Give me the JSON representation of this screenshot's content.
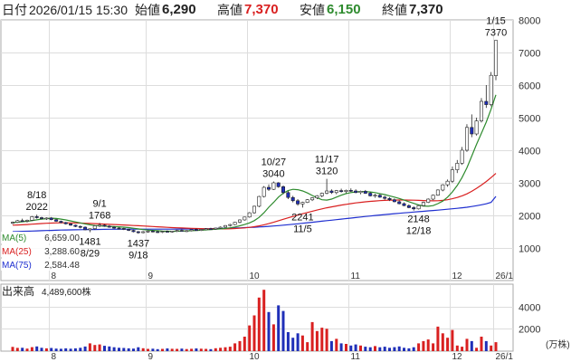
{
  "header": {
    "date_label": "日付",
    "date_value": "2026/01/15 15:30",
    "open_label": "始値",
    "open_value": "6,290",
    "high_label": "高値",
    "high_value": "7,370",
    "low_label": "安値",
    "low_value": "6,150",
    "close_label": "終値",
    "close_value": "7,370"
  },
  "colors": {
    "up_candle": "#ffffff",
    "down_candle": "#1f2fb8",
    "ma5": "#2e8b2e",
    "ma25": "#d92020",
    "ma75": "#1f2fd0",
    "volume_up": "#d92020",
    "volume_down": "#1f2fb8",
    "high_value_text": "#d92020",
    "low_value_text": "#2e8b2e"
  },
  "chart_data": {
    "type": "candlestick",
    "price_panel": {
      "ylim": [
        0,
        8000
      ],
      "y_ticks": [
        1000,
        2000,
        3000,
        4000,
        5000,
        6000,
        7000,
        8000
      ],
      "x_tick_labels": [
        "8",
        "9",
        "10",
        "11",
        "12",
        "26/1"
      ],
      "grid": true,
      "legend": [
        {
          "name": "MA(5)",
          "value": "6,659.00",
          "color": "#2e8b2e"
        },
        {
          "name": "MA(25)",
          "value": "3,288.60",
          "color": "#d92020"
        },
        {
          "name": "MA(75)",
          "value": "2,584.48",
          "color": "#1f2fd0"
        }
      ],
      "legend_placement": "bottom-left",
      "annotations": [
        {
          "date": "8/18",
          "value": "2022",
          "kind": "high"
        },
        {
          "date": "9/1",
          "value": "1768",
          "kind": "high"
        },
        {
          "date": "8/29",
          "value": "1481",
          "kind": "low"
        },
        {
          "date": "9/18",
          "value": "1437",
          "kind": "low"
        },
        {
          "date": "10/27",
          "value": "3040",
          "kind": "high"
        },
        {
          "date": "11/17",
          "value": "3120",
          "kind": "high"
        },
        {
          "date": "11/5",
          "value": "2241",
          "kind": "low"
        },
        {
          "date": "12/18",
          "value": "2148",
          "kind": "low"
        },
        {
          "date": "1/15",
          "value": "7370",
          "kind": "high"
        }
      ]
    },
    "volume_panel": {
      "label": "出来高",
      "value": "4,489,600株",
      "unit": "(万株)",
      "ylim": [
        0,
        6000
      ],
      "y_ticks": [
        2000,
        4000
      ],
      "x_tick_labels": [
        "8",
        "9",
        "10",
        "11",
        "12",
        "26/1"
      ]
    },
    "candles": [
      [
        1760,
        1810,
        1730,
        1790
      ],
      [
        1790,
        1860,
        1770,
        1840
      ],
      [
        1840,
        1900,
        1800,
        1820
      ],
      [
        1820,
        1870,
        1780,
        1850
      ],
      [
        1850,
        1980,
        1830,
        1960
      ],
      [
        1960,
        2022,
        1900,
        1930
      ],
      [
        1930,
        1960,
        1880,
        1900
      ],
      [
        1900,
        1940,
        1860,
        1920
      ],
      [
        1920,
        1950,
        1850,
        1870
      ],
      [
        1870,
        1890,
        1800,
        1820
      ],
      [
        1820,
        1840,
        1760,
        1780
      ],
      [
        1780,
        1800,
        1720,
        1740
      ],
      [
        1740,
        1760,
        1680,
        1700
      ],
      [
        1700,
        1720,
        1640,
        1660
      ],
      [
        1660,
        1690,
        1600,
        1640
      ],
      [
        1640,
        1660,
        1540,
        1560
      ],
      [
        1560,
        1600,
        1481,
        1590
      ],
      [
        1590,
        1700,
        1560,
        1680
      ],
      [
        1680,
        1768,
        1640,
        1700
      ],
      [
        1700,
        1730,
        1650,
        1670
      ],
      [
        1670,
        1700,
        1620,
        1640
      ],
      [
        1640,
        1660,
        1590,
        1610
      ],
      [
        1610,
        1640,
        1570,
        1600
      ],
      [
        1600,
        1620,
        1550,
        1570
      ],
      [
        1570,
        1590,
        1520,
        1540
      ],
      [
        1540,
        1560,
        1480,
        1500
      ],
      [
        1500,
        1520,
        1437,
        1470
      ],
      [
        1470,
        1520,
        1450,
        1500
      ],
      [
        1500,
        1540,
        1470,
        1520
      ],
      [
        1520,
        1550,
        1480,
        1500
      ],
      [
        1500,
        1530,
        1460,
        1490
      ],
      [
        1490,
        1520,
        1460,
        1510
      ],
      [
        1510,
        1540,
        1480,
        1500
      ],
      [
        1500,
        1530,
        1470,
        1520
      ],
      [
        1520,
        1560,
        1490,
        1540
      ],
      [
        1540,
        1570,
        1500,
        1520
      ],
      [
        1520,
        1550,
        1490,
        1530
      ],
      [
        1530,
        1570,
        1510,
        1560
      ],
      [
        1560,
        1600,
        1530,
        1540
      ],
      [
        1540,
        1580,
        1520,
        1570
      ],
      [
        1570,
        1610,
        1550,
        1590
      ],
      [
        1590,
        1620,
        1560,
        1580
      ],
      [
        1580,
        1620,
        1560,
        1610
      ],
      [
        1610,
        1660,
        1590,
        1640
      ],
      [
        1640,
        1700,
        1620,
        1690
      ],
      [
        1690,
        1740,
        1660,
        1720
      ],
      [
        1720,
        1800,
        1700,
        1790
      ],
      [
        1790,
        1880,
        1760,
        1860
      ],
      [
        1860,
        1960,
        1840,
        1950
      ],
      [
        1950,
        2100,
        1930,
        2080
      ],
      [
        2080,
        2300,
        2050,
        2280
      ],
      [
        2280,
        2600,
        2250,
        2580
      ],
      [
        2580,
        2900,
        2550,
        2860
      ],
      [
        2860,
        2950,
        2750,
        2800
      ],
      [
        2800,
        3040,
        2780,
        3000
      ],
      [
        3000,
        3020,
        2850,
        2880
      ],
      [
        2880,
        2920,
        2650,
        2700
      ],
      [
        2700,
        2750,
        2500,
        2550
      ],
      [
        2550,
        2600,
        2400,
        2450
      ],
      [
        2450,
        2500,
        2300,
        2350
      ],
      [
        2350,
        2420,
        2241,
        2400
      ],
      [
        2400,
        2500,
        2380,
        2480
      ],
      [
        2480,
        2560,
        2440,
        2540
      ],
      [
        2540,
        2620,
        2500,
        2600
      ],
      [
        2600,
        2700,
        2560,
        2680
      ],
      [
        2680,
        3120,
        2650,
        2750
      ],
      [
        2750,
        2800,
        2660,
        2700
      ],
      [
        2700,
        2780,
        2650,
        2760
      ],
      [
        2760,
        2820,
        2700,
        2730
      ],
      [
        2730,
        2790,
        2680,
        2770
      ],
      [
        2770,
        2830,
        2720,
        2750
      ],
      [
        2750,
        2800,
        2680,
        2700
      ],
      [
        2700,
        2760,
        2650,
        2740
      ],
      [
        2740,
        2780,
        2660,
        2680
      ],
      [
        2680,
        2720,
        2580,
        2600
      ],
      [
        2600,
        2660,
        2540,
        2620
      ],
      [
        2620,
        2660,
        2540,
        2560
      ],
      [
        2560,
        2600,
        2480,
        2520
      ],
      [
        2520,
        2560,
        2440,
        2480
      ],
      [
        2480,
        2520,
        2400,
        2420
      ],
      [
        2420,
        2460,
        2340,
        2360
      ],
      [
        2360,
        2400,
        2280,
        2300
      ],
      [
        2300,
        2340,
        2220,
        2240
      ],
      [
        2240,
        2280,
        2148,
        2200
      ],
      [
        2200,
        2320,
        2180,
        2300
      ],
      [
        2300,
        2420,
        2280,
        2400
      ],
      [
        2400,
        2520,
        2380,
        2500
      ],
      [
        2500,
        2640,
        2470,
        2620
      ],
      [
        2620,
        2800,
        2600,
        2780
      ],
      [
        2780,
        2960,
        2740,
        2940
      ],
      [
        2940,
        3100,
        2880,
        3050
      ],
      [
        3050,
        3500,
        3000,
        3400
      ],
      [
        3400,
        3700,
        3300,
        3600
      ],
      [
        3600,
        4100,
        3550,
        4000
      ],
      [
        4000,
        4800,
        3950,
        4700
      ],
      [
        4700,
        5100,
        4400,
        4500
      ],
      [
        4500,
        5000,
        4450,
        4900
      ],
      [
        4900,
        5600,
        4850,
        5500
      ],
      [
        5500,
        6000,
        5300,
        5400
      ],
      [
        5400,
        6400,
        5350,
        6300
      ],
      [
        6290,
        7370,
        6150,
        7370
      ]
    ],
    "ma5": [
      1780,
      1790,
      1805,
      1820,
      1840,
      1865,
      1885,
      1900,
      1915,
      1905,
      1885,
      1860,
      1830,
      1800,
      1770,
      1740,
      1710,
      1690,
      1680,
      1670,
      1660,
      1655,
      1650,
      1640,
      1625,
      1605,
      1585,
      1565,
      1550,
      1540,
      1530,
      1520,
      1515,
      1512,
      1515,
      1520,
      1525,
      1530,
      1535,
      1545,
      1555,
      1565,
      1575,
      1585,
      1600,
      1620,
      1645,
      1680,
      1720,
      1770,
      1840,
      1940,
      2080,
      2250,
      2400,
      2560,
      2680,
      2760,
      2800,
      2790,
      2750,
      2690,
      2610,
      2540,
      2480,
      2470,
      2500,
      2560,
      2620,
      2670,
      2700,
      2720,
      2730,
      2730,
      2720,
      2700,
      2670,
      2640,
      2600,
      2560,
      2520,
      2470,
      2420,
      2370,
      2320,
      2290,
      2280,
      2300,
      2360,
      2440,
      2560,
      2720,
      2920,
      3160,
      3460,
      3820,
      4180,
      4520,
      4860,
      5260,
      5700
    ],
    "ma25": [
      1700,
      1705,
      1712,
      1720,
      1730,
      1740,
      1750,
      1758,
      1765,
      1770,
      1772,
      1772,
      1770,
      1767,
      1763,
      1758,
      1752,
      1746,
      1740,
      1733,
      1726,
      1719,
      1712,
      1705,
      1698,
      1690,
      1682,
      1674,
      1666,
      1658,
      1650,
      1642,
      1634,
      1626,
      1620,
      1614,
      1608,
      1603,
      1598,
      1594,
      1590,
      1587,
      1585,
      1585,
      1586,
      1590,
      1596,
      1605,
      1617,
      1632,
      1652,
      1678,
      1710,
      1748,
      1790,
      1835,
      1880,
      1925,
      1968,
      2010,
      2050,
      2090,
      2128,
      2165,
      2200,
      2232,
      2262,
      2290,
      2316,
      2340,
      2362,
      2382,
      2400,
      2416,
      2430,
      2442,
      2452,
      2460,
      2466,
      2470,
      2472,
      2472,
      2470,
      2466,
      2460,
      2455,
      2450,
      2448,
      2450,
      2460,
      2480,
      2510,
      2550,
      2600,
      2660,
      2740,
      2830,
      2930,
      3040,
      3160,
      3288.6
    ],
    "ma75": [
      1500,
      1505,
      1510,
      1515,
      1520,
      1525,
      1530,
      1535,
      1540,
      1545,
      1550,
      1553,
      1556,
      1559,
      1562,
      1564,
      1566,
      1568,
      1570,
      1572,
      1574,
      1575,
      1576,
      1577,
      1578,
      1578,
      1578,
      1578,
      1578,
      1578,
      1578,
      1578,
      1578,
      1579,
      1580,
      1581,
      1582,
      1584,
      1586,
      1588,
      1590,
      1593,
      1596,
      1600,
      1604,
      1608,
      1613,
      1618,
      1624,
      1630,
      1637,
      1645,
      1654,
      1664,
      1675,
      1687,
      1700,
      1714,
      1728,
      1743,
      1758,
      1774,
      1790,
      1806,
      1822,
      1838,
      1854,
      1870,
      1886,
      1902,
      1918,
      1934,
      1950,
      1966,
      1981,
      1996,
      2011,
      2025,
      2039,
      2052,
      2065,
      2078,
      2090,
      2102,
      2114,
      2126,
      2138,
      2150,
      2162,
      2175,
      2188,
      2202,
      2217,
      2233,
      2251,
      2272,
      2296,
      2324,
      2356,
      2400,
      2584.48
    ],
    "volume": [
      380,
      290,
      300,
      230,
      360,
      420,
      300,
      250,
      280,
      230,
      210,
      250,
      220,
      250,
      300,
      410,
      700,
      550,
      600,
      480,
      420,
      350,
      300,
      280,
      250,
      230,
      350,
      260,
      200,
      220,
      180,
      200,
      240,
      210,
      200,
      230,
      190,
      210,
      240,
      220,
      200,
      180,
      260,
      300,
      350,
      400,
      700,
      900,
      1300,
      2300,
      3200,
      4800,
      5500,
      3500,
      2400,
      4100,
      3600,
      1700,
      1200,
      1600,
      1400,
      800,
      2600,
      1800,
      2100,
      2000,
      900,
      1100,
      700,
      650,
      500,
      600,
      500,
      400,
      350,
      450,
      350,
      400,
      300,
      360,
      420,
      300,
      250,
      350,
      700,
      900,
      1050,
      700,
      2200,
      1600,
      1200,
      1900,
      500,
      400,
      1100,
      900,
      300,
      1300,
      900,
      500,
      800
    ]
  }
}
